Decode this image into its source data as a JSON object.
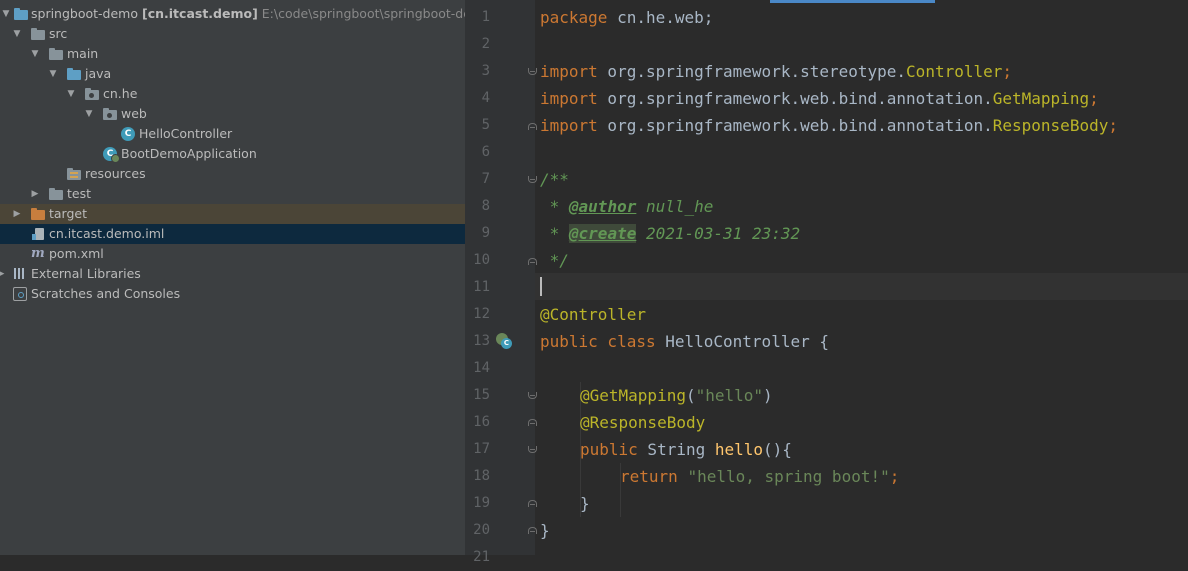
{
  "project_tree": [
    {
      "label": "springboot-demo",
      "bold": "[cn.itcast.demo]",
      "path": "E:\\code\\springboot\\springboot-demo",
      "twisty": "▼",
      "icon": "module-folder-icon"
    },
    {
      "label": "src",
      "twisty": "▼",
      "icon": "folder-icon"
    },
    {
      "label": "main",
      "twisty": "▼",
      "icon": "folder-icon"
    },
    {
      "label": "java",
      "twisty": "▼",
      "icon": "source-folder-icon"
    },
    {
      "label": "cn.he",
      "twisty": "▼",
      "icon": "package-icon"
    },
    {
      "label": "web",
      "twisty": "▼",
      "icon": "package-icon"
    },
    {
      "label": "HelloController",
      "twisty": "",
      "icon": "java-class-icon"
    },
    {
      "label": "BootDemoApplication",
      "twisty": "",
      "icon": "spring-boot-app-icon"
    },
    {
      "label": "resources",
      "twisty": "",
      "icon": "resources-folder-icon"
    },
    {
      "label": "test",
      "twisty": "▶",
      "icon": "folder-icon"
    },
    {
      "label": "target",
      "twisty": "▶",
      "icon": "excluded-folder-icon"
    },
    {
      "label": "cn.itcast.demo.iml",
      "twisty": "",
      "icon": "iml-file-icon"
    },
    {
      "label": "pom.xml",
      "twisty": "",
      "icon": "maven-icon"
    },
    {
      "label": "External Libraries",
      "twisty": "▶",
      "icon": "library-icon"
    },
    {
      "label": "Scratches and Consoles",
      "twisty": "",
      "icon": "scratches-icon"
    }
  ],
  "editor": {
    "line_numbers": [
      "1",
      "2",
      "3",
      "4",
      "5",
      "6",
      "7",
      "8",
      "9",
      "10",
      "11",
      "12",
      "13",
      "14",
      "15",
      "16",
      "17",
      "18",
      "19",
      "20",
      "21"
    ],
    "code": {
      "l1_kw": "package",
      "l1_rest": " cn.he.web;",
      "l3_kw": "import",
      "l3_rest": " org.springframework.stereotype.",
      "l3_cls": "Controller",
      "l3_end": ";",
      "l4_kw": "import",
      "l4_rest": " org.springframework.web.bind.annotation.",
      "l4_cls": "GetMapping",
      "l4_end": ";",
      "l5_kw": "import",
      "l5_rest": " org.springframework.web.bind.annotation.",
      "l5_cls": "ResponseBody",
      "l5_end": ";",
      "l7": "/**",
      "l8_pre": " * ",
      "l8_tag": "@author",
      "l8_val": " null_he",
      "l9_pre": " * ",
      "l9_tag": "@create",
      "l9_val": " 2021-03-31 23:32",
      "l10": " */",
      "l12": "@Controller",
      "l13_kw": "public class",
      "l13_rest": " HelloController {",
      "l15_ann": "@GetMapping",
      "l15_p1": "(",
      "l15_str": "\"hello\"",
      "l15_p2": ")",
      "l16": "@ResponseBody",
      "l17_kw": "public",
      "l17_type": " String ",
      "l17_fn": "hello",
      "l17_rest": "(){",
      "l18_kw": "return",
      "l18_sp": " ",
      "l18_str": "\"hello, spring boot!\"",
      "l18_end": ";",
      "l19": "}",
      "l20": "}"
    }
  },
  "colors": {
    "keyword": "#cc7832",
    "annotation": "#bbb529",
    "string": "#6a8759",
    "doc": "#629755",
    "method": "#ffc66d",
    "text": "#a9b7c6"
  }
}
